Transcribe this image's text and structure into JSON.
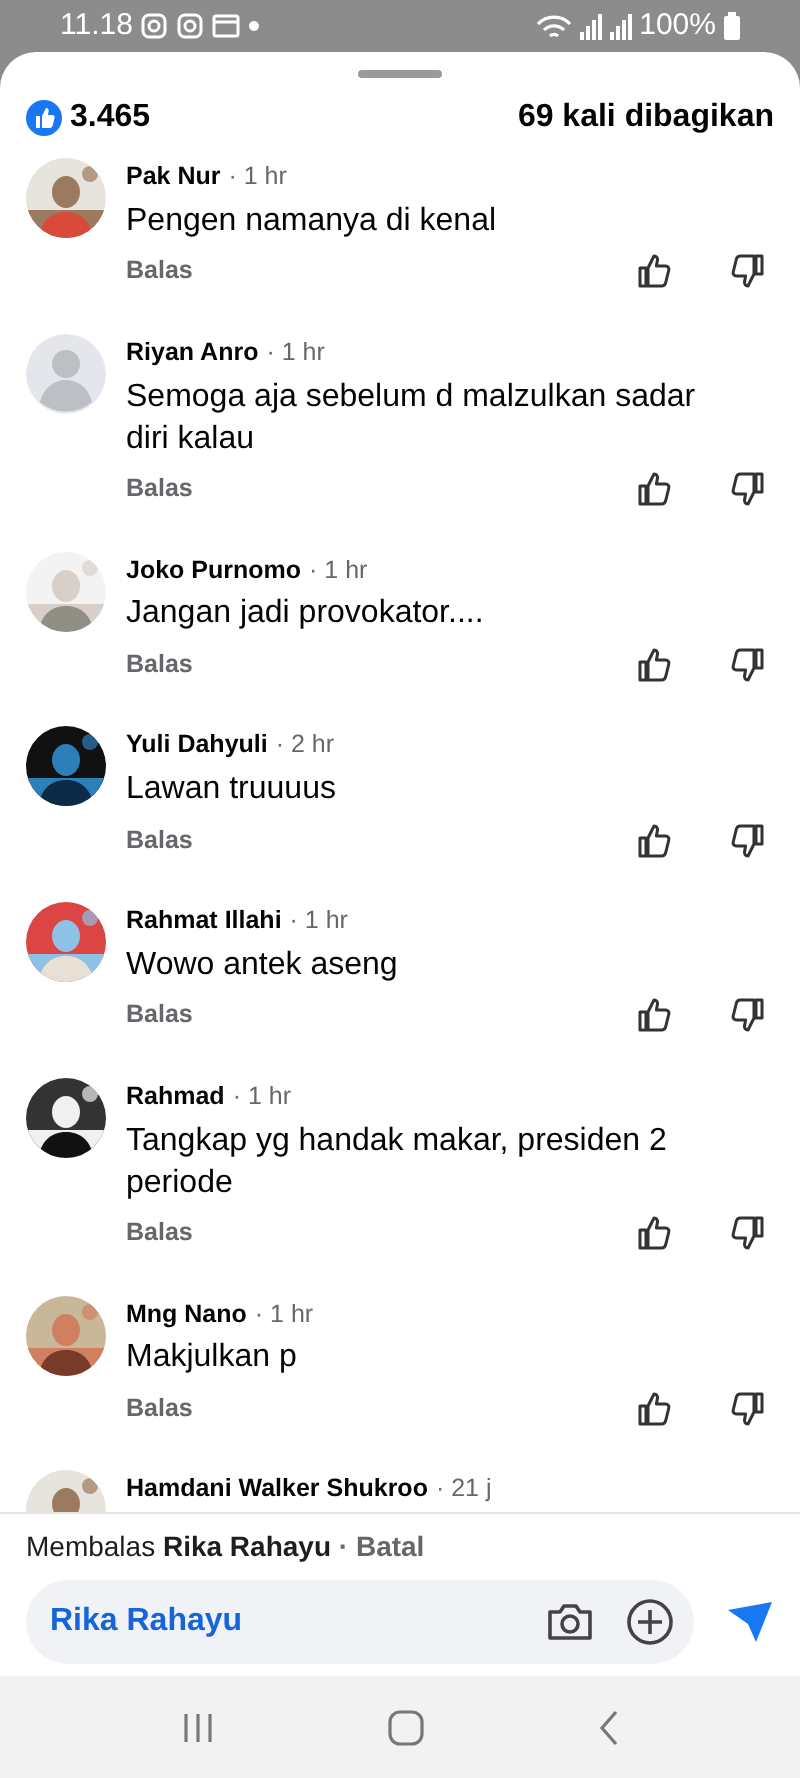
{
  "status_bar": {
    "time": "11.18",
    "battery": "100%"
  },
  "header": {
    "like_count": "3.465",
    "shares": "69 kali dibagikan"
  },
  "comments": [
    {
      "name": "Pak Nur",
      "time": "· 1 hr",
      "text": "Pengen namanya di kenal",
      "reply": "Balas"
    },
    {
      "name": "Riyan Anro",
      "time": "· 1 hr",
      "text": "Semoga aja sebelum d malzulkan sadar diri kalau",
      "reply": "Balas",
      "avatar": {
        "kind": "default"
      }
    },
    {
      "name": "Joko Purnomo",
      "time": "· 1 hr",
      "text": "Jangan jadi provokator....",
      "reply": "Balas"
    },
    {
      "name": "Yuli Dahyuli",
      "time": "· 2 hr",
      "text": "Lawan truuuus",
      "reply": "Balas"
    },
    {
      "name": "Rahmat Illahi",
      "time": "· 1 hr",
      "text": "Wowo antek aseng",
      "reply": "Balas"
    },
    {
      "name": "Rahmad",
      "time": "· 1 hr",
      "text": "Tangkap yg handak makar, presiden 2 periode",
      "reply": "Balas"
    },
    {
      "name": "Mng Nano",
      "time": "· 1 hr",
      "text": "Makjulkan p",
      "reply": "Balas"
    },
    {
      "name": "Hamdani Walker Shukroo",
      "time": "· 21 j"
    }
  ],
  "composer": {
    "replying_prefix": "Membalas",
    "replying_to": "Rika Rahayu",
    "cancel": "· Batal",
    "value": "Rika Rahayu"
  }
}
